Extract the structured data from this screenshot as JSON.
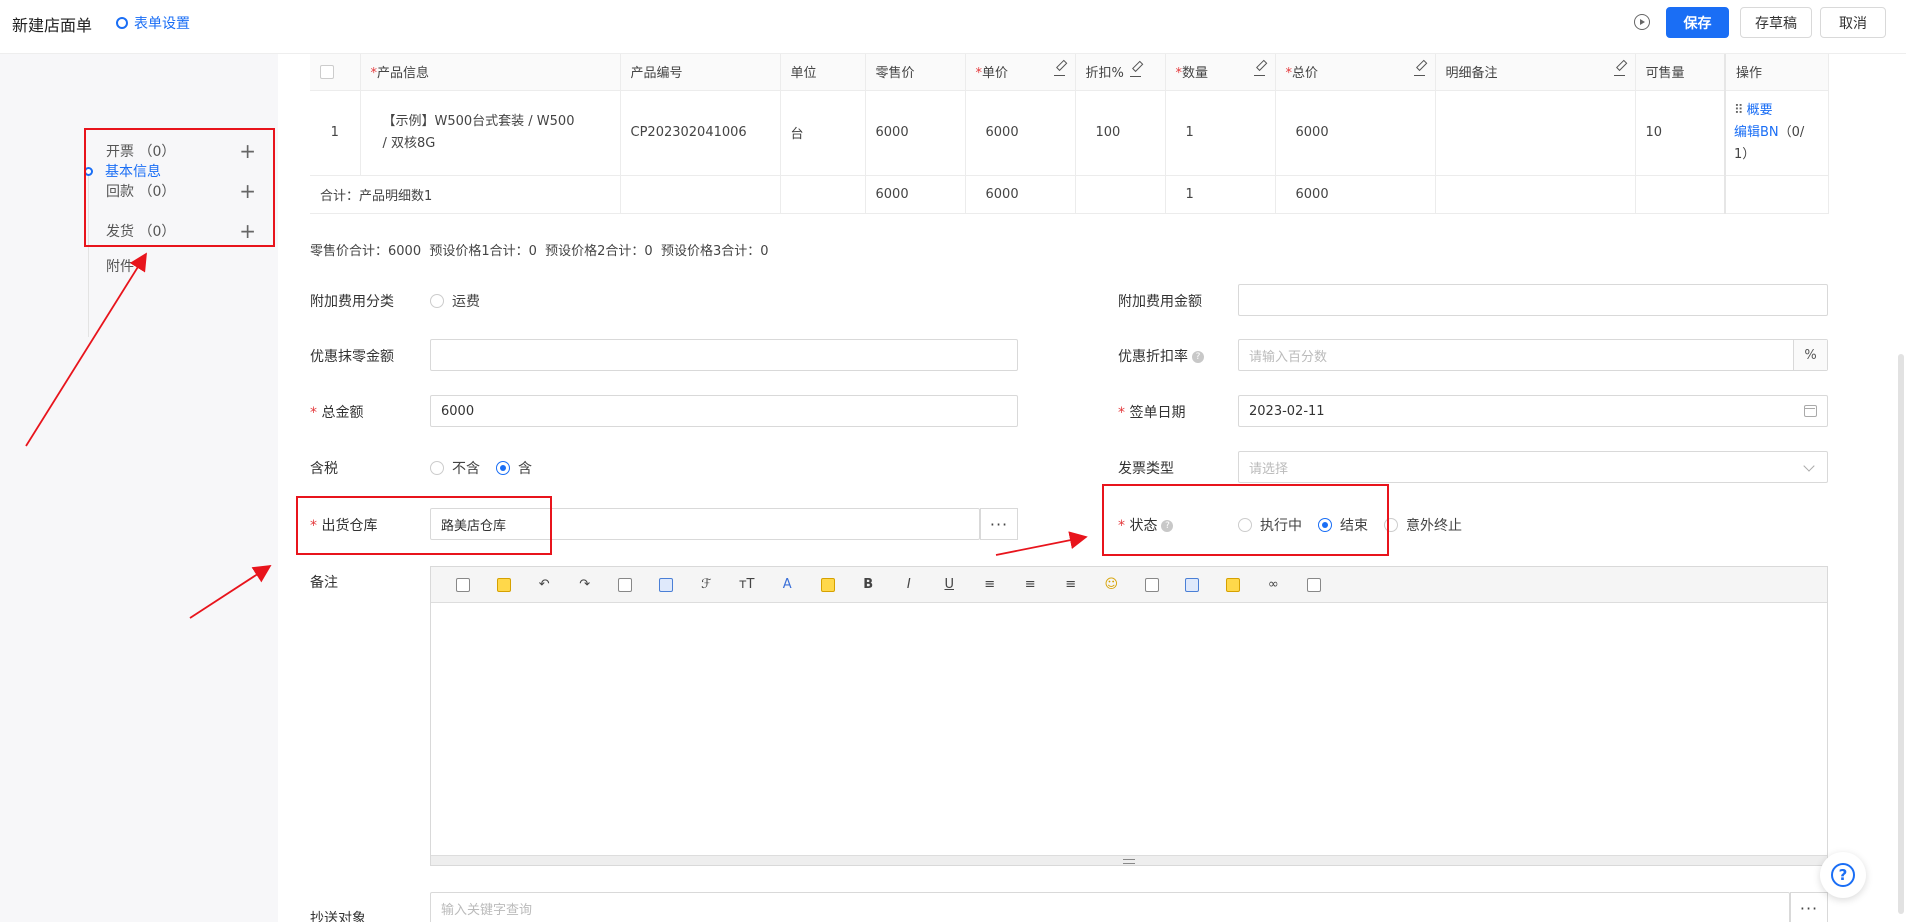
{
  "header": {
    "title": "新建店面单",
    "form_settings": "表单设置",
    "save": "保存",
    "draft": "存草稿",
    "cancel": "取消"
  },
  "leftnav": {
    "basic": "基本信息",
    "items": [
      {
        "label": "开票 （0）"
      },
      {
        "label": "回款 （0）"
      },
      {
        "label": "发货 （0）"
      }
    ],
    "attach": "附件"
  },
  "table": {
    "headers": [
      "产品信息",
      "产品编号",
      "单位",
      "零售价",
      "单价",
      "折扣%",
      "数量",
      "总价",
      "明细备注",
      "可售量",
      "操作"
    ],
    "row": {
      "index": "1",
      "product_l1": "【示例】W500台式套装 / W500",
      "product_l2": "/ 双核8G",
      "code": "CP202302041006",
      "unit": "台",
      "retail": "6000",
      "price": "6000",
      "discount": "100",
      "qty": "1",
      "total": "6000",
      "note": "",
      "available": "10",
      "op_summary": "概要",
      "op_edit": "编辑BN",
      "op_count": "（0/",
      "op_count2": "1）"
    },
    "sum": {
      "label": "合计：产品明细数1",
      "retail": "6000",
      "price": "6000",
      "qty": "1",
      "total": "6000"
    }
  },
  "price_summary": "零售价合计：6000  预设价格1合计：0  预设价格2合计：0  预设价格3合计：0",
  "form": {
    "extra_fee_type_label": "附加费用分类",
    "extra_fee_type_option": "运费",
    "extra_fee_amount_label": "附加费用金额",
    "round_off_label": "优惠抹零金额",
    "discount_rate_label": "优惠折扣率",
    "discount_rate_placeholder": "请输入百分数",
    "discount_rate_suffix": "%",
    "total_label": "总金额",
    "total_value": "6000",
    "sign_date_label": "签单日期",
    "sign_date_value": "2023-02-11",
    "tax_label": "含税",
    "tax_options": [
      "不含",
      "含"
    ],
    "invoice_type_label": "发票类型",
    "invoice_type_placeholder": "请选择",
    "warehouse_label": "出货仓库",
    "warehouse_value": "路美店仓库",
    "status_label": "状态",
    "status_options": [
      "执行中",
      "结束",
      "意外终止"
    ],
    "remark_label": "备注",
    "cc_label": "抄送对象",
    "cc_placeholder": "输入关键字查询"
  },
  "toolbar_glyphs": {
    "bold": "B",
    "italic": "I",
    "underline": "U",
    "font_size": "тT",
    "font_color": "A",
    "font_family": "ℱ",
    "emoji": "☺"
  },
  "misc": {
    "more": "···",
    "help": "?",
    "help_small": "?",
    "drag": "⠿",
    "plus": "+"
  },
  "colors": {
    "accent": "#1a6ef5",
    "annotation": "#e8141c"
  }
}
